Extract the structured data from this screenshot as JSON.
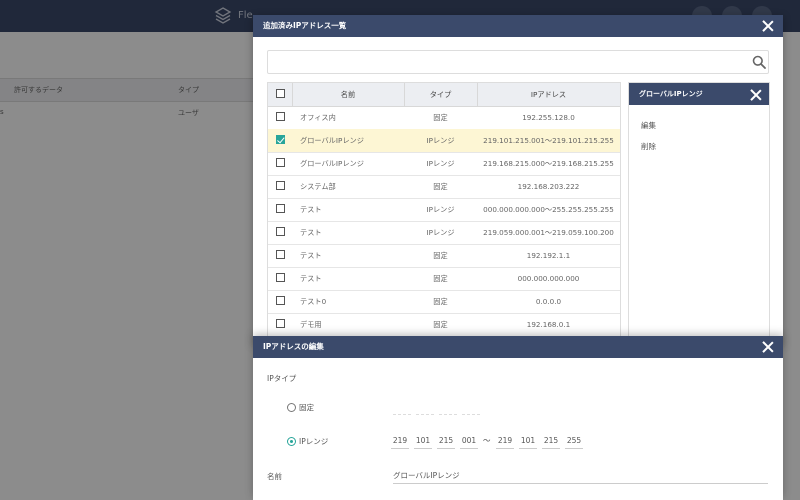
{
  "app": {
    "brand": "Fle"
  },
  "background_table": {
    "col_allowed": "許可するデータ",
    "col_type": "タイプ",
    "row_type": "ユーザ",
    "row_marker": "s"
  },
  "ip_list_dialog": {
    "title": "追加済みIPアドレス一覧",
    "search": {
      "value": "",
      "placeholder": ""
    },
    "columns": {
      "name": "名前",
      "type": "タイプ",
      "ip": "IPアドレス"
    },
    "rows": [
      {
        "name": "オフィス内",
        "type": "固定",
        "ip": "192.255.128.0",
        "checked": false
      },
      {
        "name": "グローバルIPレンジ",
        "type": "IPレンジ",
        "ip": "219.101.215.001〜219.101.215.255",
        "checked": true
      },
      {
        "name": "グローバルIPレンジ",
        "type": "IPレンジ",
        "ip": "219.168.215.000〜219.168.215.255",
        "checked": false
      },
      {
        "name": "システム部",
        "type": "固定",
        "ip": "192.168.203.222",
        "checked": false
      },
      {
        "name": "テスト",
        "type": "IPレンジ",
        "ip": "000.000.000.000〜255.255.255.255",
        "checked": false
      },
      {
        "name": "テスト",
        "type": "IPレンジ",
        "ip": "219.059.000.001〜219.059.100.200",
        "checked": false
      },
      {
        "name": "テスト",
        "type": "固定",
        "ip": "192.192.1.1",
        "checked": false
      },
      {
        "name": "テスト",
        "type": "固定",
        "ip": "000.000.000.000",
        "checked": false
      },
      {
        "name": "テスト0",
        "type": "固定",
        "ip": "0.0.0.0",
        "checked": false
      },
      {
        "name": "デモ用",
        "type": "固定",
        "ip": "192.168.0.1",
        "checked": false
      }
    ],
    "side_panel": {
      "title": "グローバルIPレンジ",
      "actions": [
        "編集",
        "削除"
      ]
    }
  },
  "edit_dialog": {
    "title": "IPアドレスの編集",
    "ip_type_label": "IPタイプ",
    "option_fixed": "固定",
    "option_range": "IPレンジ",
    "selected_option": "IPレンジ",
    "range_start": [
      "219",
      "101",
      "215",
      "001"
    ],
    "range_separator": "〜",
    "range_end": [
      "219",
      "101",
      "215",
      "255"
    ],
    "name_label": "名前",
    "name_value": "グローバルIPレンジ"
  },
  "colors": {
    "header": "#3b4a6b",
    "accent": "#28a59a",
    "selected_row": "#fdf6d4"
  }
}
